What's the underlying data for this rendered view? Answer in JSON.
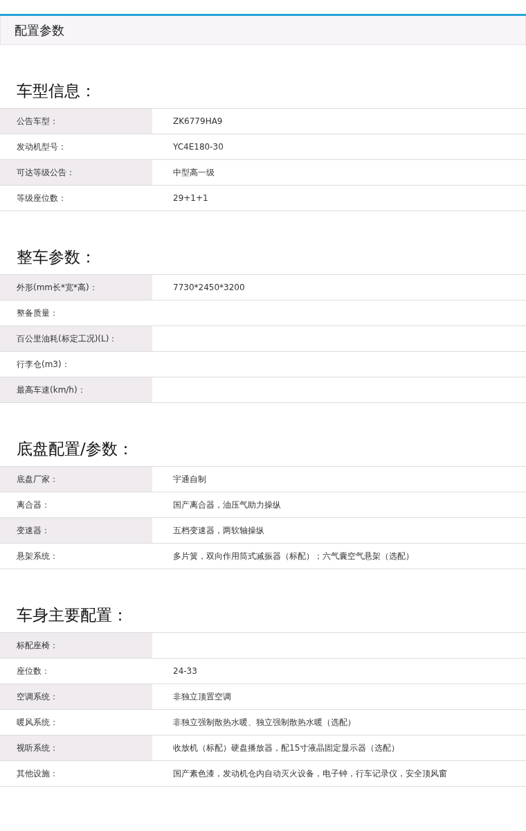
{
  "header": {
    "title": "配置参数"
  },
  "sections": [
    {
      "title": "车型信息：",
      "rows": [
        {
          "label": "公告车型：",
          "value": "ZK6779HA9"
        },
        {
          "label": "发动机型号：",
          "value": "YC4E180-30"
        },
        {
          "label": "可达等级公告：",
          "value": "中型高一级"
        },
        {
          "label": "等级座位数：",
          "value": "29+1+1"
        }
      ]
    },
    {
      "title": "整车参数：",
      "rows": [
        {
          "label": "外形(mm长*宽*高)：",
          "value": "7730*2450*3200"
        },
        {
          "label": "整备质量："
        },
        {
          "label": "百公里油耗(标定工况)(L)："
        },
        {
          "label": "行李仓(m3)："
        },
        {
          "label": "最高车速(km/h)："
        }
      ]
    },
    {
      "title": "底盘配置/参数：",
      "rows": [
        {
          "label": "底盘厂家：",
          "value": "宇通自制"
        },
        {
          "label": "离合器：",
          "value": "国产离合器，油压气助力操纵"
        },
        {
          "label": "变速器：",
          "value": "五档变速器，两软轴操纵"
        },
        {
          "label": "悬架系统：",
          "value": "多片簧，双向作用筒式减振器（标配）；六气囊空气悬架（选配）"
        }
      ]
    },
    {
      "title": "车身主要配置：",
      "rows": [
        {
          "label": "标配座椅："
        },
        {
          "label": "座位数：",
          "value": "24-33"
        },
        {
          "label": "空调系统：",
          "value": "非独立顶置空调"
        },
        {
          "label": "暖风系统：",
          "value": "非独立强制散热水暖、独立强制散热水暖（选配）"
        },
        {
          "label": "视听系统：",
          "value": "收放机（标配）硬盘播放器，配15寸液晶固定显示器（选配）"
        },
        {
          "label": "其他设施：",
          "value": "国产素色漆，发动机仓内自动灭火设备，电子钟，行车记录仪，安全顶风窗"
        }
      ]
    }
  ]
}
